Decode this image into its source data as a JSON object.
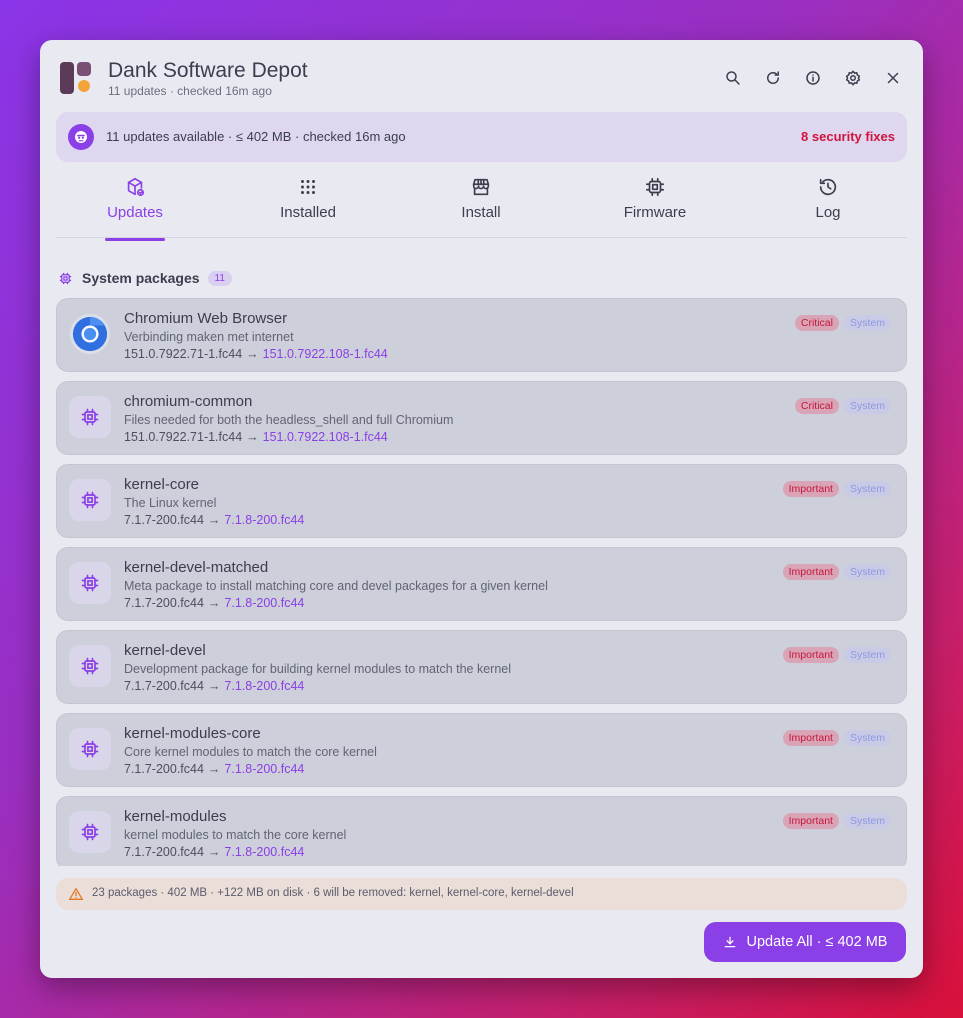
{
  "header": {
    "title": "Dank Software Depot",
    "subtitle": "11 updates · checked 16m ago",
    "actions": [
      "search-icon",
      "refresh-icon",
      "info-icon",
      "gear-icon",
      "close-icon"
    ]
  },
  "banner": {
    "icon": "package-bot-icon",
    "text": "11 updates available · ≤ 402 MB · checked 16m ago",
    "security": "8 security fixes"
  },
  "tabs": [
    {
      "label": "Updates",
      "icon": "package-update-icon",
      "active": true
    },
    {
      "label": "Installed",
      "icon": "grid-dots-icon",
      "active": false
    },
    {
      "label": "Install",
      "icon": "store-icon",
      "active": false
    },
    {
      "label": "Firmware",
      "icon": "chip-icon",
      "active": false
    },
    {
      "label": "Log",
      "icon": "history-icon",
      "active": false
    }
  ],
  "section": {
    "icon": "chip-icon",
    "title": "System packages",
    "count": "11"
  },
  "packages": [
    {
      "name": "Chromium Web Browser",
      "desc": "Verbinding maken met internet",
      "old": "151.0.7922.71-1.fc44",
      "new": "151.0.7922.108-1.fc44",
      "severity": "Critical",
      "category": "System",
      "icon": "chromium-icon"
    },
    {
      "name": "chromium-common",
      "desc": "Files needed for both the headless_shell and full Chromium",
      "old": "151.0.7922.71-1.fc44",
      "new": "151.0.7922.108-1.fc44",
      "severity": "Critical",
      "category": "System",
      "icon": "chip-icon"
    },
    {
      "name": "kernel-core",
      "desc": "The Linux kernel",
      "old": "7.1.7-200.fc44",
      "new": "7.1.8-200.fc44",
      "severity": "Important",
      "category": "System",
      "icon": "chip-icon"
    },
    {
      "name": "kernel-devel-matched",
      "desc": "Meta package to install matching core and devel packages for a given kernel",
      "old": "7.1.7-200.fc44",
      "new": "7.1.8-200.fc44",
      "severity": "Important",
      "category": "System",
      "icon": "chip-icon"
    },
    {
      "name": "kernel-devel",
      "desc": "Development package for building kernel modules to match the kernel",
      "old": "7.1.7-200.fc44",
      "new": "7.1.8-200.fc44",
      "severity": "Important",
      "category": "System",
      "icon": "chip-icon"
    },
    {
      "name": "kernel-modules-core",
      "desc": "Core kernel modules to match the core kernel",
      "old": "7.1.7-200.fc44",
      "new": "7.1.8-200.fc44",
      "severity": "Important",
      "category": "System",
      "icon": "chip-icon"
    },
    {
      "name": "kernel-modules",
      "desc": "kernel modules to match the core kernel",
      "old": "7.1.7-200.fc44",
      "new": "7.1.8-200.fc44",
      "severity": "Important",
      "category": "System",
      "icon": "chip-icon"
    }
  ],
  "footer": {
    "icon": "warning-icon",
    "note": "23 packages · 402 MB · +122 MB on disk · 6 will be removed: kernel, kernel-core, kernel-devel",
    "button_label": "Update All · ≤ 402 MB",
    "button_icon": "download-icon"
  },
  "colors": {
    "accent": "#8b3fe6",
    "critical": "#d0143e",
    "warning": "#e07a25"
  }
}
